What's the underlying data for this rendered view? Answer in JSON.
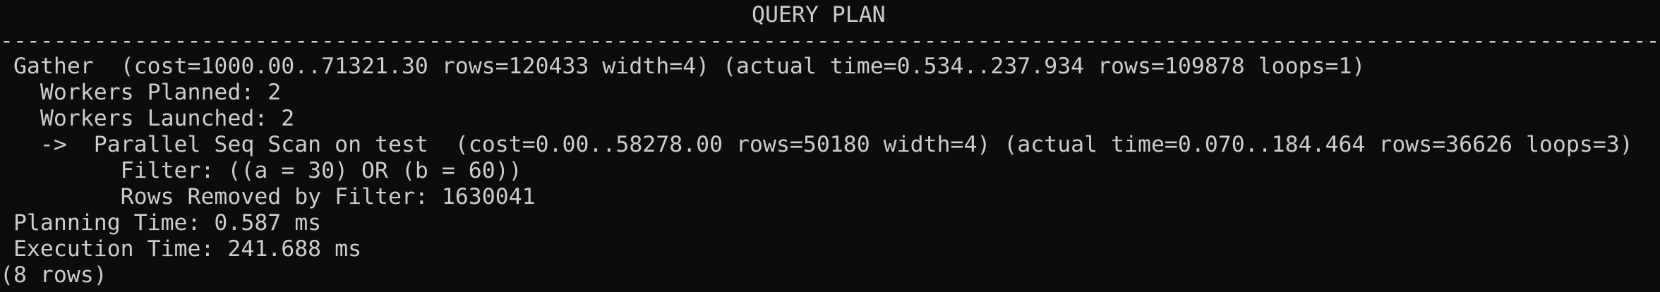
{
  "terminal": {
    "background_color": "#0c0c0c",
    "text_color": "#cccccc",
    "header": "QUERY PLAN",
    "rule": "--------------------------------------------------------------------------------------------------------------------------------",
    "plan_lines": [
      " Gather  (cost=1000.00..71321.30 rows=120433 width=4) (actual time=0.534..237.934 rows=109878 loops=1)",
      "   Workers Planned: 2",
      "   Workers Launched: 2",
      "   ->  Parallel Seq Scan on test  (cost=0.00..58278.00 rows=50180 width=4) (actual time=0.070..184.464 rows=36626 loops=3)",
      "         Filter: ((a = 30) OR (b = 60))",
      "         Rows Removed by Filter: 1630041",
      " Planning Time: 0.587 ms",
      " Execution Time: 241.688 ms"
    ],
    "row_count": "(8 rows)"
  }
}
